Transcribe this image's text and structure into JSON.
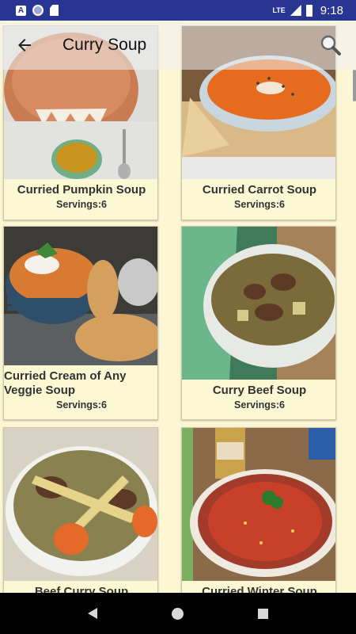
{
  "status_bar": {
    "network": "LTE",
    "time": "9:18",
    "icons": [
      "app-notification-icon",
      "globe-icon",
      "sd-card-icon",
      "signal-icon",
      "battery-icon"
    ]
  },
  "toolbar": {
    "title": "Curry Soup",
    "back_icon": "arrow-back-icon",
    "search_icon": "search-icon"
  },
  "recipes": [
    {
      "title": "Curried Pumpkin Soup",
      "servings": "Servings:6"
    },
    {
      "title": "Curried Carrot Soup",
      "servings": "Servings:6"
    },
    {
      "title": "Curried Cream of Any Veggie Soup",
      "servings": "Servings:6"
    },
    {
      "title": "Curry Beef Soup",
      "servings": "Servings:6"
    },
    {
      "title": "Beef Curry Soup",
      "servings": ""
    },
    {
      "title": "Curried Winter Soup",
      "servings": ""
    }
  ],
  "nav_bar": {
    "back_icon": "nav-back-icon",
    "home_icon": "nav-home-icon",
    "recents_icon": "nav-recents-icon"
  }
}
